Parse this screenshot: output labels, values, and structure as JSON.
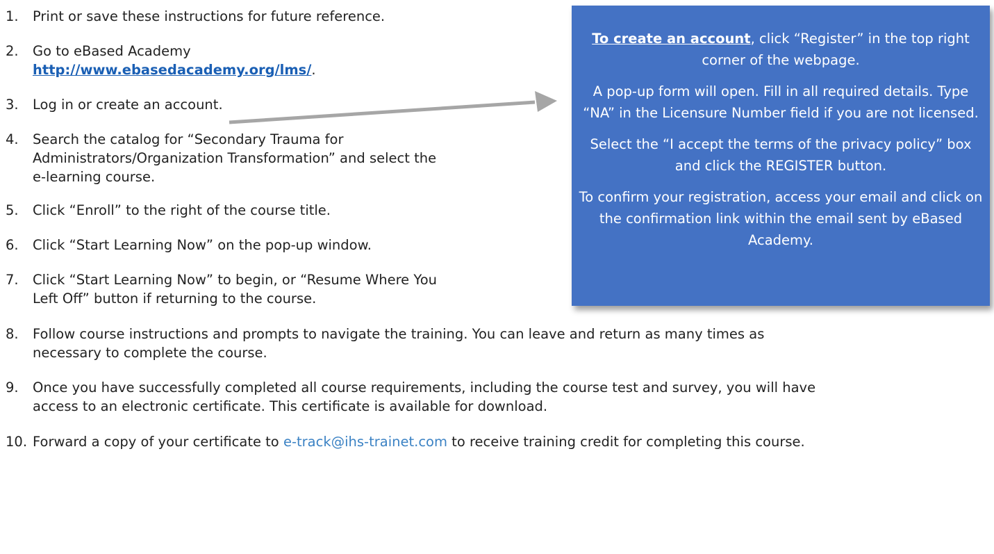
{
  "steps": [
    {
      "num": "1.",
      "lines": [
        "Print or save these instructions for future reference."
      ]
    },
    {
      "num": "2.",
      "lines": [
        "Go to eBased Academy"
      ],
      "link": "http://www.ebasedacademy.org/lms/",
      "link_suffix": "."
    },
    {
      "num": "3.",
      "lines": [
        "Log in or create an account."
      ]
    },
    {
      "num": "4.",
      "lines": [
        "Search the catalog for “Secondary Trauma for",
        "Administrators/Organization Transformation” and select the",
        "e-learning course."
      ]
    },
    {
      "num": "5.",
      "lines": [
        "Click “Enroll” to the right of the course title."
      ]
    },
    {
      "num": "6.",
      "lines": [
        "Click “Start Learning Now” on the pop-up window."
      ]
    },
    {
      "num": "7.",
      "lines": [
        "Click “Start Learning Now” to begin, or “Resume Where You",
        "Left Off” button if returning to the course."
      ]
    },
    {
      "num": "8.",
      "lines": [
        "Follow course instructions and prompts to navigate the training. You can leave and return as many times as",
        "necessary to complete the course."
      ]
    },
    {
      "num": "9.",
      "lines": [
        "Once you have successfully completed all course requirements, including the course test and survey, you will have",
        "access to an electronic certificate. This certificate is available for download."
      ]
    },
    {
      "num": "10.",
      "prefix": "Forward a copy of your certificate to ",
      "email": "e-track@ihs-trainet.com",
      "suffix": " to receive training credit for completing this course."
    }
  ],
  "callout": {
    "bold_lead": "To create an account",
    "p1_rest": ", click “Register” in the top right corner of the webpage.",
    "p2": "A pop-up form will open. Fill in all required details. Type “NA” in the Licensure Number field if you are not licensed.",
    "p3": "Select the “I accept the terms of the privacy policy” box and click the REGISTER button.",
    "p4": "To confirm your registration, access your email and click on the confirmation link within the email sent by eBased Academy."
  },
  "colors": {
    "callout_bg": "#4472c4",
    "link": "#1a5fb4",
    "email": "#3b82c4",
    "arrow": "#a6a6a6"
  }
}
